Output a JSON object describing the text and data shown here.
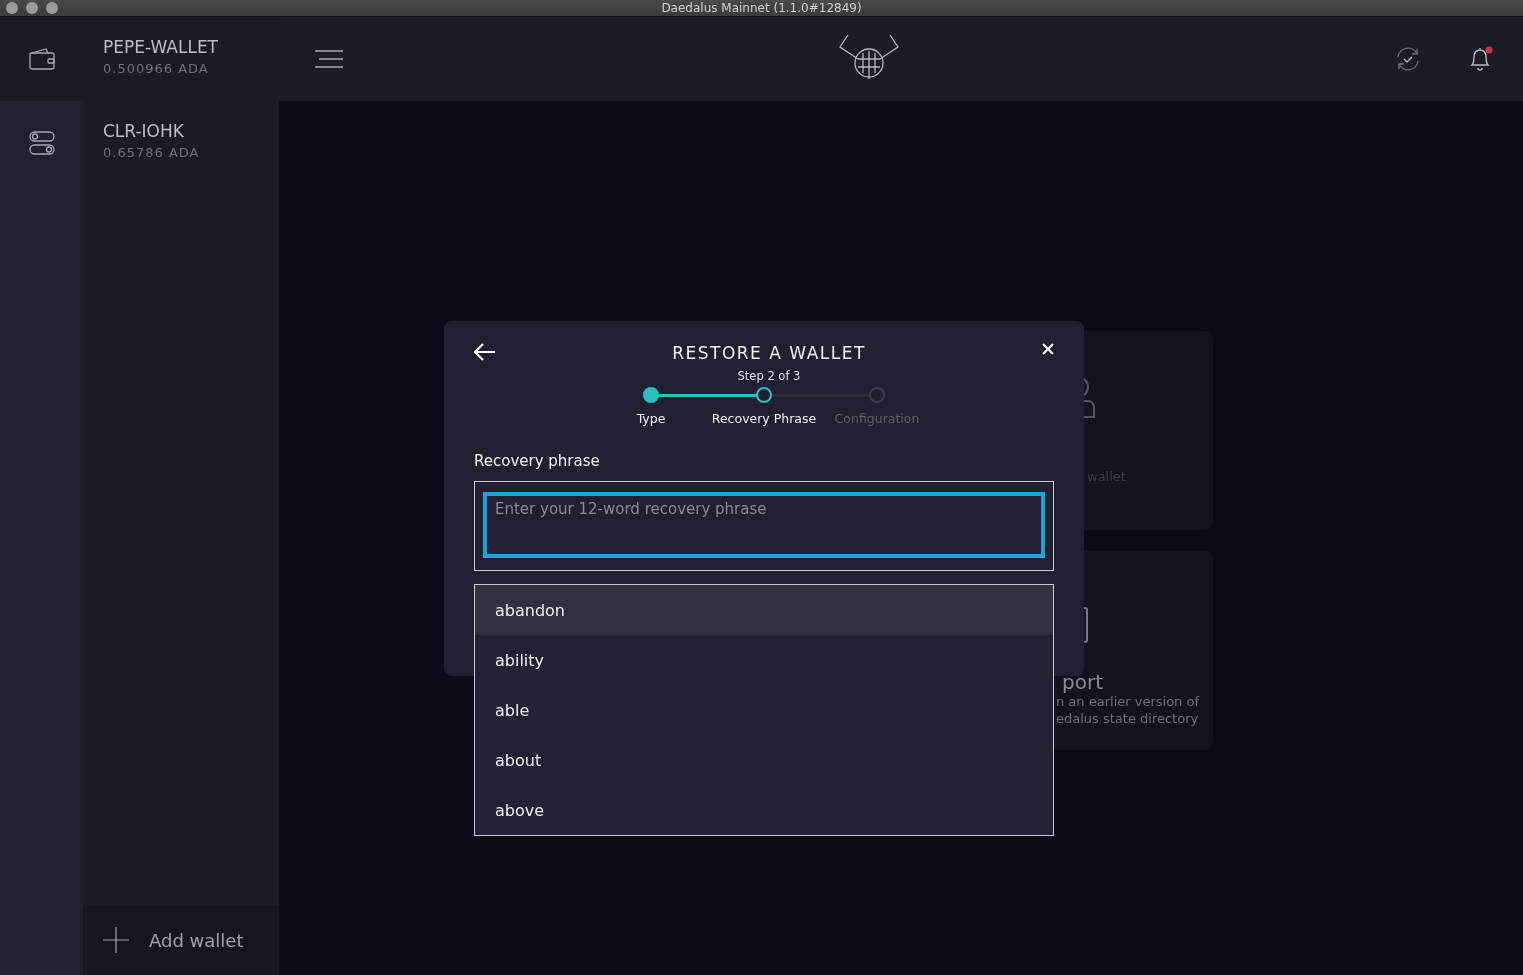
{
  "window": {
    "title": "Daedalus Mainnet (1.1.0#12849)"
  },
  "wallets": [
    {
      "name": "PEPE-WALLET",
      "balance": "0.500966 ADA"
    },
    {
      "name": "CLR-IOHK",
      "balance": "0.65786 ADA"
    }
  ],
  "add_wallet": {
    "label": "Add wallet"
  },
  "notifications": {
    "unread": true
  },
  "background_cards": [
    {
      "text": "wallet"
    },
    {
      "title": "port",
      "lines": [
        "n an earlier version of",
        "edalus state directory"
      ]
    }
  ],
  "dialog": {
    "title": "RESTORE A WALLET",
    "subtitle": "Step 2 of 3",
    "steps": [
      {
        "label": "Type",
        "completed": true,
        "selected": false
      },
      {
        "label": "Recovery Phrase",
        "completed": false,
        "selected": true
      },
      {
        "label": "Configuration",
        "completed": false,
        "selected": false
      }
    ],
    "field": {
      "label": "Recovery phrase",
      "placeholder": "Enter your 12-word recovery phrase",
      "focused": true
    },
    "suggestions": [
      {
        "word": "abandon",
        "selected": true
      },
      {
        "word": "ability",
        "selected": false
      },
      {
        "word": "able",
        "selected": false
      },
      {
        "word": "about",
        "selected": false
      },
      {
        "word": "above",
        "selected": false
      }
    ]
  }
}
